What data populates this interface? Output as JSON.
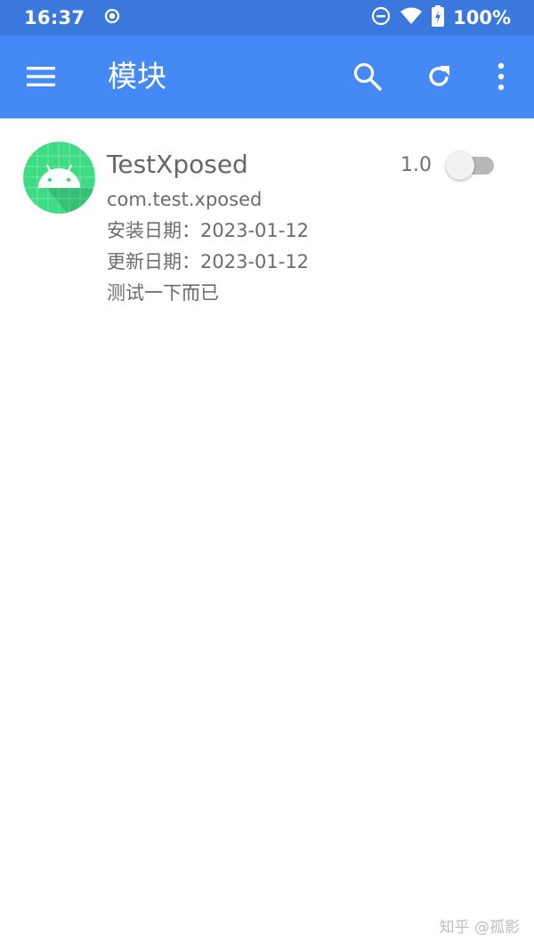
{
  "status_bar": {
    "time": "16:37",
    "battery": "100%",
    "icons": [
      "record-icon",
      "do-not-disturb-icon",
      "wifi-icon",
      "battery-charging-icon"
    ]
  },
  "app_bar": {
    "title": "模块",
    "icons": [
      "menu-icon",
      "search-icon",
      "refresh-icon",
      "more-vert-icon"
    ]
  },
  "module": {
    "icon": "android-icon",
    "name": "TestXposed",
    "version": "1.0",
    "enabled": false,
    "package": "com.test.xposed",
    "install_date": "安装日期：2023-01-12",
    "update_date": "更新日期：2023-01-12",
    "description": "测试一下而已"
  },
  "watermark": "知乎 @孤影",
  "colors": {
    "status_bar": "#3a78de",
    "app_bar": "#4489f6",
    "icon_bg": "#3ddc84"
  }
}
